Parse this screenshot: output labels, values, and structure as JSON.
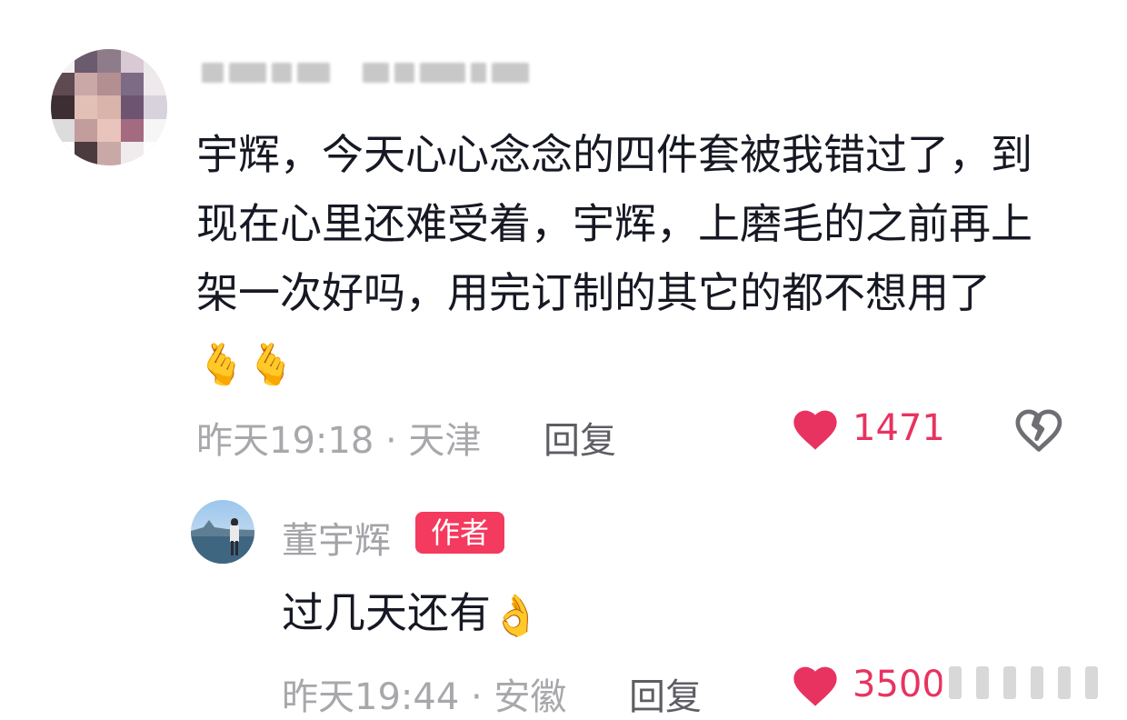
{
  "comment": {
    "text": "宇辉，今天心心念念的四件套被我错过了，到现在心里还难受着，宇辉，上磨毛的之前再上架一次好吗，用完订制的其它的都不想用了",
    "emoji": "🫰🫰",
    "time_location": "昨天19:18 · 天津",
    "reply_label": "回复",
    "like_count": "1471"
  },
  "reply": {
    "username": "董宇辉",
    "badge": "作者",
    "text": "过几天还有",
    "emoji": "👌",
    "time_location": "昨天19:44 · 安徽",
    "reply_label": "回复",
    "like_count": "3500"
  },
  "colors": {
    "like_red": "#e83360",
    "badge_red": "#f43a5e",
    "text_dark": "#161823",
    "meta_gray": "#a8a8ac"
  },
  "icons": {
    "like": "heart-icon",
    "dislike": "broken-heart-icon"
  }
}
